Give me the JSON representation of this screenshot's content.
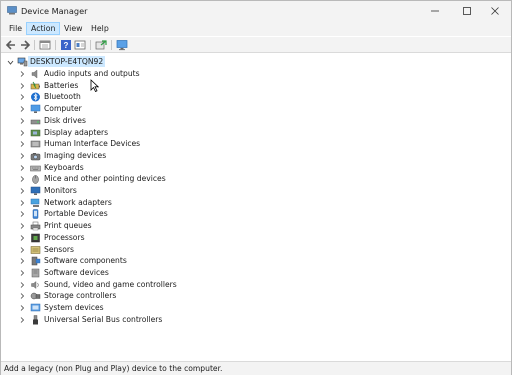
{
  "window": {
    "title": "Device Manager"
  },
  "menu": {
    "items": [
      "File",
      "Action",
      "View",
      "Help"
    ],
    "active": "Action"
  },
  "toolbar": {
    "buttons": [
      "back-icon",
      "forward-icon",
      "properties-pane-icon",
      "help-icon",
      "details-icon",
      "scan-icon",
      "monitor-icon"
    ]
  },
  "tree": {
    "root": "DESKTOP-E4TQN92",
    "categories": [
      "Audio inputs and outputs",
      "Batteries",
      "Bluetooth",
      "Computer",
      "Disk drives",
      "Display adapters",
      "Human Interface Devices",
      "Imaging devices",
      "Keyboards",
      "Mice and other pointing devices",
      "Monitors",
      "Network adapters",
      "Portable Devices",
      "Print queues",
      "Processors",
      "Sensors",
      "Software components",
      "Software devices",
      "Sound, video and game controllers",
      "Storage controllers",
      "System devices",
      "Universal Serial Bus controllers"
    ]
  },
  "status": {
    "text": "Add a legacy (non Plug and Play) device to the computer."
  },
  "colors": {
    "selection": "#cce8ff",
    "chrome": "#f3f3f3",
    "accent": "#1e6fcf"
  }
}
